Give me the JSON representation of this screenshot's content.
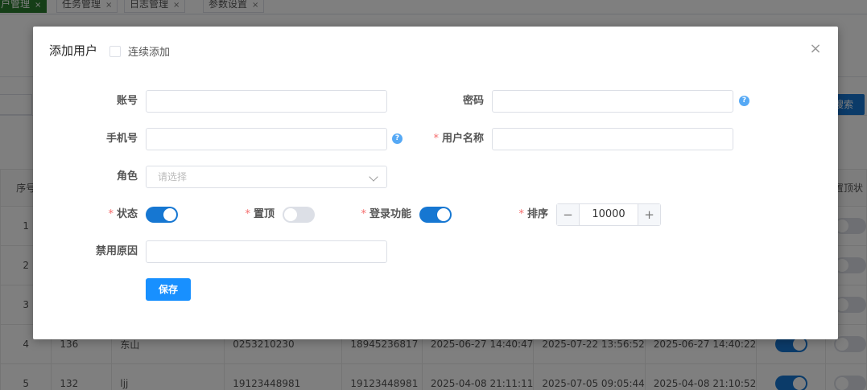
{
  "background": {
    "tabs": [
      {
        "label": "户管理",
        "active": true
      },
      {
        "label": "任务管理",
        "active": false
      },
      {
        "label": "日志管理",
        "active": false
      },
      {
        "label": "参数设置",
        "active": false
      }
    ],
    "tab_close_glyph": "×",
    "search_button_label": "搜索",
    "table": {
      "headers": {
        "index": "序号",
        "pin_status": "置顶状"
      },
      "rows": [
        {
          "index": "1",
          "id": "",
          "name": "",
          "account": "",
          "phone": "",
          "created": "",
          "updated": "",
          "login": "",
          "status_on": true,
          "pinned": false
        },
        {
          "index": "2",
          "id": "",
          "name": "",
          "account": "",
          "phone": "",
          "created": "",
          "updated": "",
          "login": "",
          "status_on": true,
          "pinned": false
        },
        {
          "index": "3",
          "id": "",
          "name": "",
          "account": "",
          "phone": "",
          "created": "",
          "updated": "",
          "login": "",
          "status_on": true,
          "pinned": false
        },
        {
          "index": "4",
          "id": "136",
          "name": "东山",
          "account": "0253210230",
          "phone": "18945236817",
          "created": "2025-06-27 14:40:47",
          "updated": "2025-07-22 13:56:52",
          "login": "2025-06-27 14:40:22",
          "status_on": true,
          "pinned": false
        },
        {
          "index": "5",
          "id": "132",
          "name": "ljj",
          "account": "19123448981",
          "phone": "19123448981",
          "created": "2025-04-08 21:11:11",
          "updated": "2025-07-05 09:05:44",
          "login": "2025-04-08 21:10:52",
          "status_on": true,
          "pinned": false
        }
      ]
    }
  },
  "dialog": {
    "title": "添加用户",
    "continuous_add_label": "连续添加",
    "continuous_add_checked": false,
    "close_glyph": "×",
    "fields": {
      "account": {
        "label": "账号",
        "value": ""
      },
      "password": {
        "label": "密码",
        "value": ""
      },
      "phone": {
        "label": "手机号",
        "value": ""
      },
      "username": {
        "label": "用户名称",
        "required": "*",
        "value": ""
      },
      "role": {
        "label": "角色",
        "placeholder": "请选择"
      },
      "status": {
        "label": "状态",
        "required": "*",
        "on": true
      },
      "pin": {
        "label": "置顶",
        "required": "*",
        "on": false
      },
      "login": {
        "label": "登录功能",
        "required": "*",
        "on": true
      },
      "sort": {
        "label": "排序",
        "required": "*",
        "value": "10000",
        "minus": "−",
        "plus": "+"
      },
      "ban_reason": {
        "label": "禁用原因",
        "value": ""
      }
    },
    "help_glyph": "?",
    "save_label": "保存"
  },
  "colors": {
    "primary": "#1890ff",
    "switch_on": "#1677d2",
    "required": "#f56c6c",
    "active_tab": "#2b7d2f"
  }
}
